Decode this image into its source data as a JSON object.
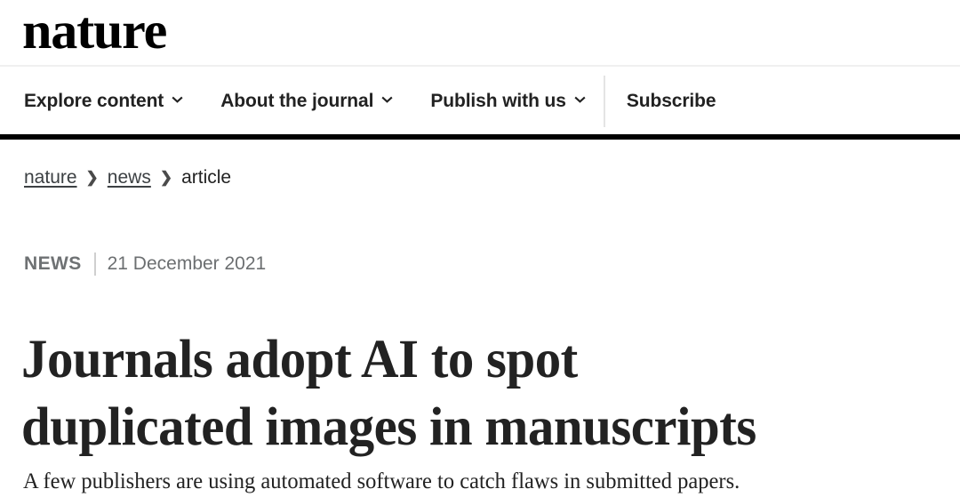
{
  "site": {
    "logo_text": "nature"
  },
  "nav": {
    "items": [
      {
        "label": "Explore content",
        "has_dropdown": true,
        "icon": "chevron-down-icon"
      },
      {
        "label": "About the journal",
        "has_dropdown": true,
        "icon": "chevron-down-icon"
      },
      {
        "label": "Publish with us",
        "has_dropdown": true,
        "icon": "chevron-down-icon"
      }
    ],
    "subscribe_label": "Subscribe"
  },
  "breadcrumb": {
    "items": [
      {
        "label": "nature",
        "is_link": true
      },
      {
        "label": "news",
        "is_link": true
      },
      {
        "label": "article",
        "is_link": false
      }
    ],
    "separator": "›"
  },
  "article": {
    "kicker": "NEWS",
    "date": "21 December 2021",
    "headline_line_1": "Journals adopt AI to spot",
    "headline_line_2": "duplicated images in manuscripts",
    "standfirst": "A few publishers are using automated software to catch flaws in submitted papers."
  },
  "colors": {
    "text_primary": "#222222",
    "text_muted": "#6c6f71",
    "rule_black": "#000000",
    "divider_light": "#f0f0f0",
    "background": "#ffffff"
  }
}
